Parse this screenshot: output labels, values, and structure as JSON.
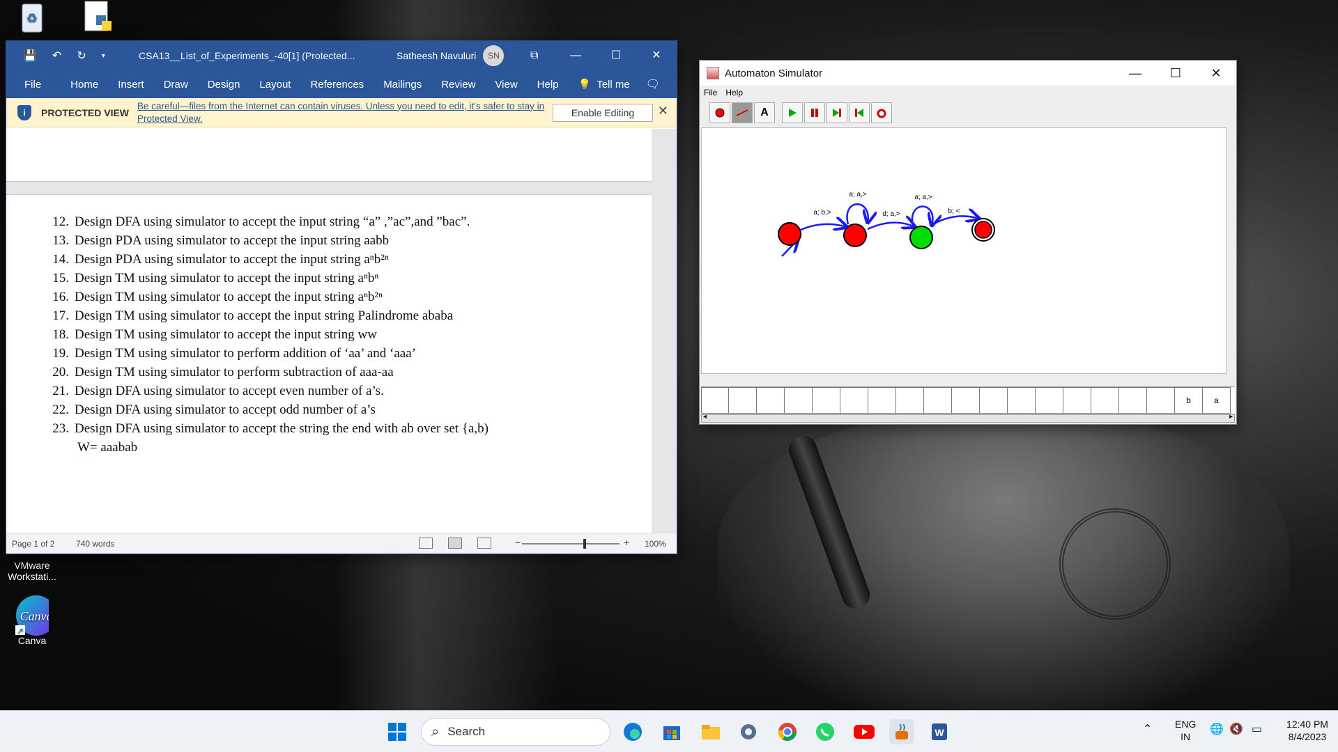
{
  "desktop": {
    "icons": [
      {
        "label": "VMware Workstati...",
        "icon": "vmware-icon"
      },
      {
        "label": "Canva",
        "icon": "canva-icon",
        "badge": "Canva"
      }
    ]
  },
  "word": {
    "title": "CSA13__List_of_Experiments_-40[1] (Protected...",
    "user_name": "Satheesh Navuluri",
    "user_initials": "SN",
    "tabs": [
      "File",
      "Home",
      "Insert",
      "Draw",
      "Design",
      "Layout",
      "References",
      "Mailings",
      "Review",
      "View",
      "Help"
    ],
    "tell_me": "Tell me",
    "protected_label": "PROTECTED VIEW",
    "protected_message": "Be careful—files from the Internet can contain viruses. Unless you need to edit, it's safer to stay in Protected View.",
    "enable_editing": "Enable Editing",
    "list": [
      {
        "num": "12.",
        "text": "Design DFA  using simulator to accept the input string “a” ,”ac”,and ”bac”."
      },
      {
        "num": "13.",
        "text": "Design PDA using simulator to accept the input string aabb"
      },
      {
        "num": "14.",
        "text": "Design PDA using simulator to accept the input string  aⁿb²ⁿ"
      },
      {
        "num": "15.",
        "text": "Design TM using simulator to accept the input string aⁿbⁿ"
      },
      {
        "num": "16.",
        "text": "Design TM using simulator to accept the input string aⁿb²ⁿ"
      },
      {
        "num": "17.",
        "text": "Design TM using simulator to accept the input string Palindrome  ababa"
      },
      {
        "num": "18.",
        "text": "Design TM using simulator to accept the input string  ww"
      },
      {
        "num": "19.",
        "text": "Design TM using simulator to perform addition of ‘aa’ and ‘aaa’"
      },
      {
        "num": "20.",
        "text": "Design TM using simulator to perform subtraction of aaa-aa"
      },
      {
        "num": "21.",
        "text": "Design DFA  using simulator to  accept even number of a’s."
      },
      {
        "num": "22.",
        "text": "Design DFA using simulator to accept odd number of a’s"
      },
      {
        "num": "23.",
        "text": "Design DFA using simulator to accept the string the end with ab over set {a,b)"
      }
    ],
    "w_line": "W=  aaabab",
    "status_page": "Page 1 of 2",
    "status_words": "740 words",
    "zoom_minus": "−",
    "zoom_plus": "+",
    "zoom": "100%",
    "zoom_fraction": 0.65
  },
  "automaton": {
    "title": "Automaton Simulator",
    "menu": [
      "File",
      "Help"
    ],
    "edge_labels": [
      "a; a,>",
      "a; b,>",
      "d; a,>",
      "a; a,>",
      "b; <"
    ],
    "tape": [
      "",
      "",
      "",
      "",
      "",
      "",
      "",
      "",
      "",
      "",
      "",
      "",
      "",
      "",
      "",
      "",
      "",
      "b",
      "a"
    ]
  },
  "taskbar": {
    "search_placeholder": "Search",
    "lang_top": "ENG",
    "lang_bottom": "IN",
    "time": "12:40 PM",
    "date": "8/4/2023"
  },
  "colors": {
    "word_blue": "#2b579a",
    "state_red": "#ff0000",
    "state_green": "#00dd00",
    "edge_blue": "#1a1aff"
  }
}
